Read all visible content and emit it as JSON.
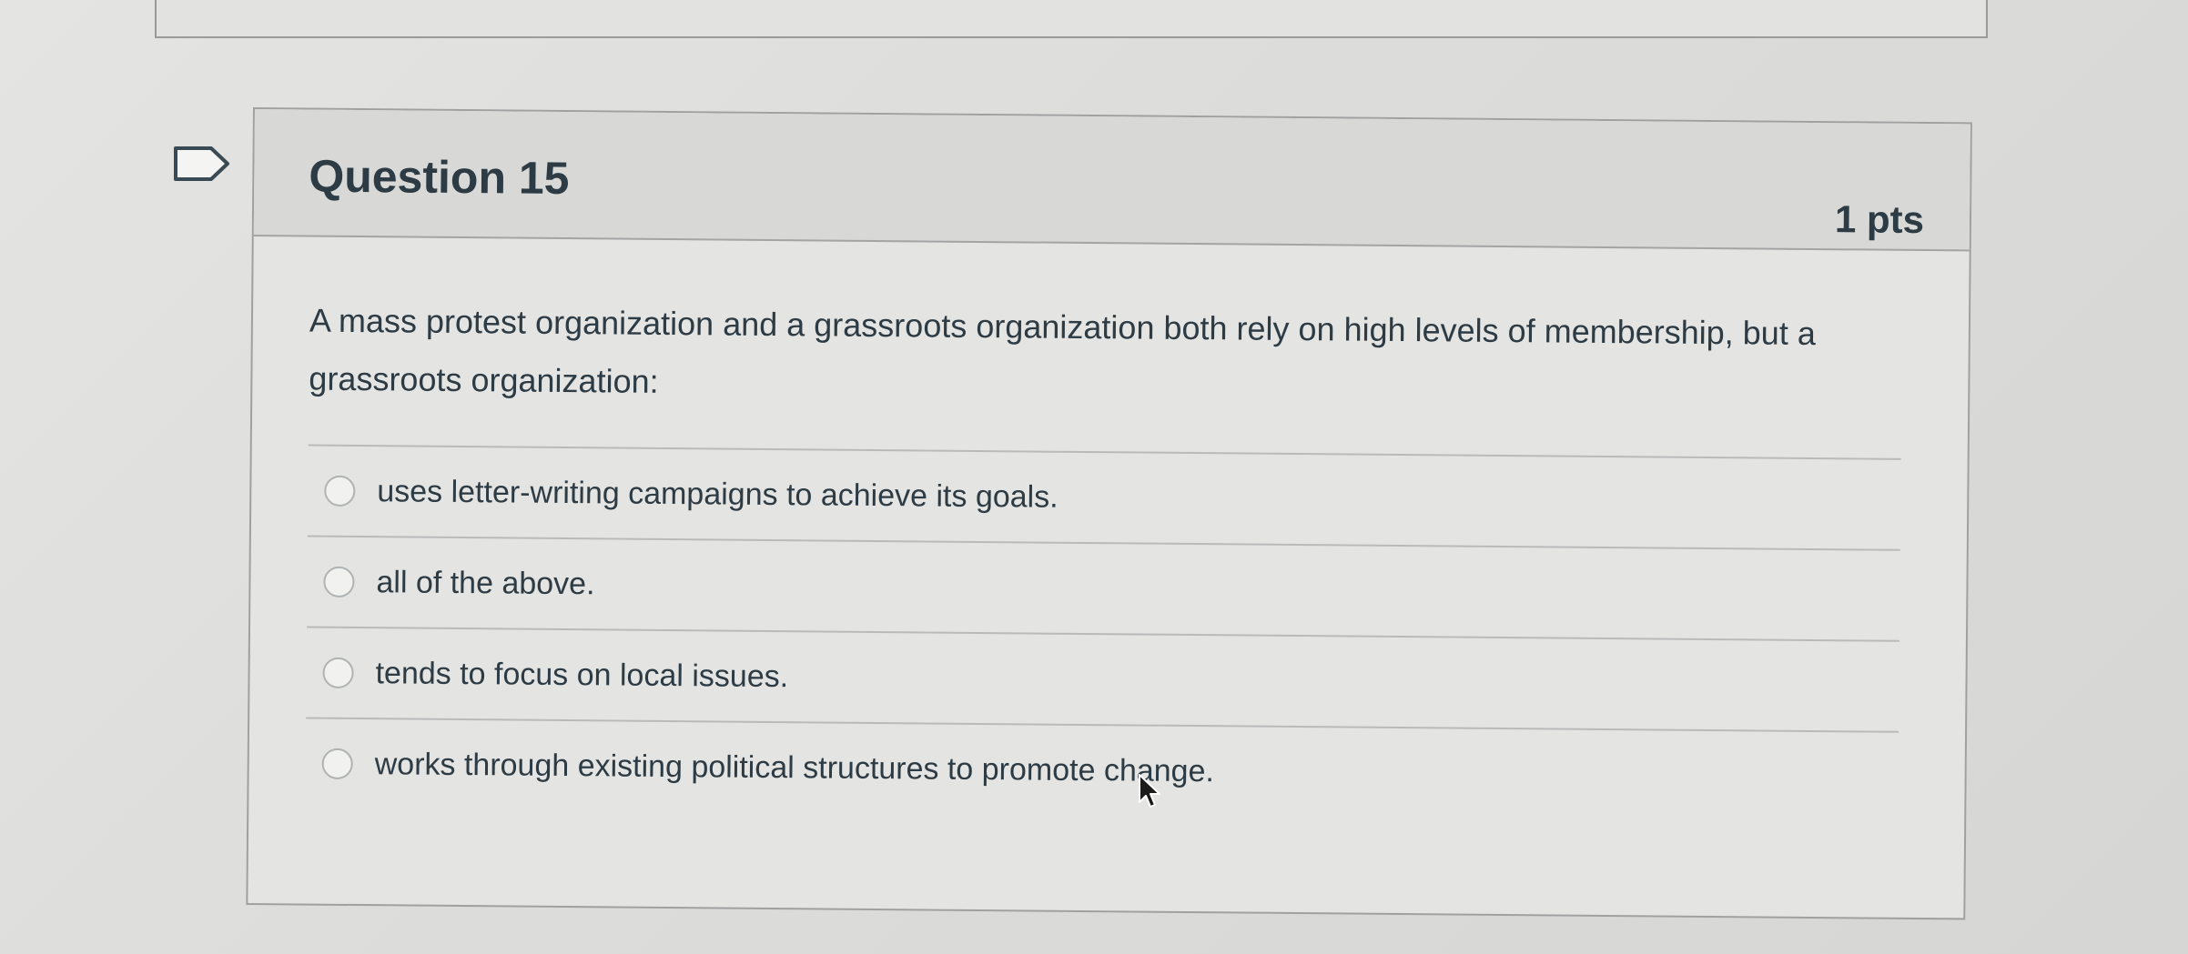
{
  "question": {
    "title": "Question 15",
    "points": "1 pts",
    "text": "A mass protest organization and a grassroots organization both rely on high levels of membership, but a grassroots organization:",
    "answers": [
      "uses letter-writing campaigns to achieve its goals.",
      "all of the above.",
      "tends to focus on local issues.",
      "works through existing political structures to promote change."
    ]
  },
  "icons": {
    "flag": "flag-outline-icon",
    "cursor": "mouse-pointer-icon"
  },
  "colors": {
    "text": "#2d3b45",
    "border": "#9fa1a1",
    "header_bg": "#d8d9d7"
  }
}
